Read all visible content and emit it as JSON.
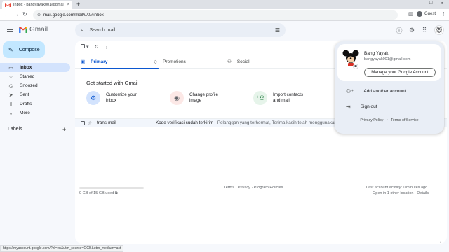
{
  "browser": {
    "tab_title": "Inbox - bangyayak001@gmail.c",
    "tab_close": "×",
    "new_tab": "+",
    "url": "mail.google.com/mail/u/0/#inbox",
    "profile_label": "Guest",
    "win_min": "–",
    "win_max": "□",
    "win_close": "✕"
  },
  "gmail": {
    "logo_text": "Gmail",
    "search_placeholder": "Search mail",
    "compose_label": "Compose",
    "nav": [
      {
        "label": "Inbox",
        "icon": "inbox-icon",
        "glyph": "▭"
      },
      {
        "label": "Starred",
        "icon": "star-icon",
        "glyph": "☆"
      },
      {
        "label": "Snoozed",
        "icon": "clock-icon",
        "glyph": "◷"
      },
      {
        "label": "Sent",
        "icon": "send-icon",
        "glyph": "➤"
      },
      {
        "label": "Drafts",
        "icon": "draft-icon",
        "glyph": "▯"
      },
      {
        "label": "More",
        "icon": "chevron-down-icon",
        "glyph": "⌄"
      }
    ],
    "labels_heading": "Labels",
    "labels_add": "+",
    "categories": [
      {
        "label": "Primary",
        "glyph": "▣"
      },
      {
        "label": "Promotions",
        "glyph": "◇"
      },
      {
        "label": "Social",
        "glyph": "⚇"
      }
    ],
    "get_started_title": "Get started with Gmail",
    "get_started": [
      {
        "line1": "Customize your",
        "line2": "inbox",
        "glyph": "⚙",
        "color": "#d3e3fd",
        "fg": "#0b57d0"
      },
      {
        "line1": "Change profile",
        "line2": "image",
        "glyph": "◉",
        "color": "#fce8e6",
        "fg": "#5f6368"
      },
      {
        "line1": "Import contacts",
        "line2": "and mail",
        "glyph": "⁺⚇",
        "color": "#e6f4ea",
        "fg": "#137333"
      }
    ],
    "email": {
      "sender": "trans-mail",
      "subject": "Kode verifikasi sudah terkirim",
      "snippet": " - Pelanggan yang terhormat, Terima kasih telah menggunakan La..."
    },
    "storage": "0 GB of 15 GB used",
    "footer_links": "Terms · Privacy · Program Policies",
    "activity_line1": "Last account activity: 0 minutes ago",
    "activity_line2": "Open in 1 other location · Details"
  },
  "account_popup": {
    "name": "Bang Yayak",
    "email": "bangyayak001@gmail.com",
    "manage_label": "Manage your Google Account",
    "add_account_label": "Add another account",
    "sign_out_label": "Sign out",
    "privacy_label": "Privacy Policy",
    "separator": "•",
    "terms_label": "Terms of Service"
  },
  "status_url": "https://myaccount.google.com/?hl=en&utm_source=OGB&utm_medium=act",
  "colors": {
    "accent": "#0b57d0",
    "compose_bg": "#c2e7ff",
    "active_nav": "#d3e3fd"
  }
}
